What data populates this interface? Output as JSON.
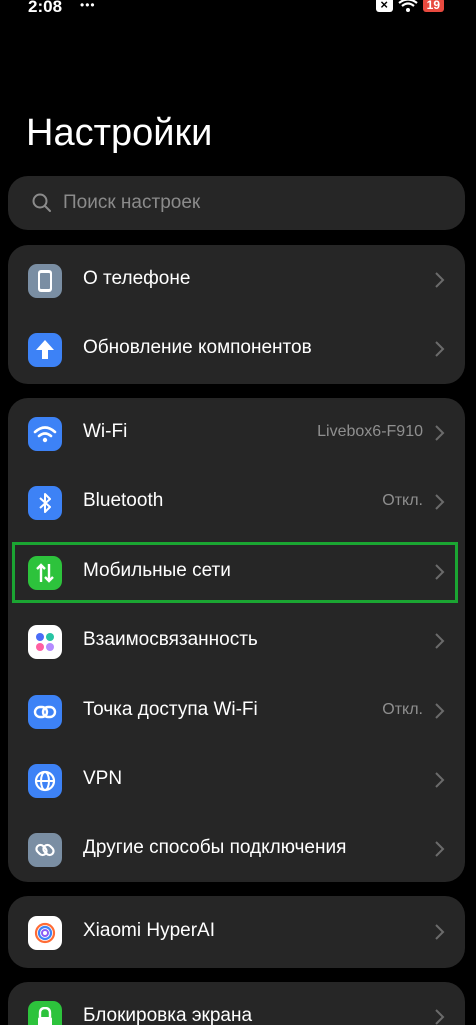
{
  "status": {
    "time": "2:08",
    "notif": "•••",
    "sim": "×",
    "battery": "19"
  },
  "title": "Настройки",
  "search": {
    "placeholder": "Поиск настроек",
    "value": ""
  },
  "groups": [
    {
      "rows": [
        {
          "label": "О телефоне",
          "value": "",
          "icon": "phone-icon",
          "color": "#7a8ea3"
        },
        {
          "label": "Обновление компонентов",
          "value": "",
          "icon": "update-arrow-icon",
          "color": "#3d82f6"
        }
      ]
    },
    {
      "rows": [
        {
          "label": "Wi-Fi",
          "value": "Livebox6-F910",
          "icon": "wifi-icon",
          "color": "#3d82f6"
        },
        {
          "label": "Bluetooth",
          "value": "Откл.",
          "icon": "bluetooth-icon",
          "color": "#3d82f6"
        },
        {
          "label": "Мобильные сети",
          "value": "",
          "icon": "mobile-data-icon",
          "color": "#2dc33c"
        },
        {
          "label": "Взаимосвязанность",
          "value": "",
          "icon": "interconnect-icon",
          "color": "#ffffff"
        },
        {
          "label": "Точка доступа Wi-Fi",
          "value": "Откл.",
          "icon": "hotspot-icon",
          "color": "#3d82f6"
        },
        {
          "label": "VPN",
          "value": "",
          "icon": "globe-icon",
          "color": "#3d82f6"
        },
        {
          "label": "Другие способы подключения",
          "value": "",
          "icon": "link-icon",
          "color": "#7a8ea3"
        }
      ]
    },
    {
      "rows": [
        {
          "label": "Xiaomi HyperAI",
          "value": "",
          "icon": "hyperai-icon",
          "color": "#ffffff"
        }
      ]
    },
    {
      "rows": [
        {
          "label": "Блокировка экрана",
          "value": "",
          "icon": "lock-icon",
          "color": "#2dc33c"
        }
      ]
    }
  ],
  "highlight_color": "#1ba532"
}
